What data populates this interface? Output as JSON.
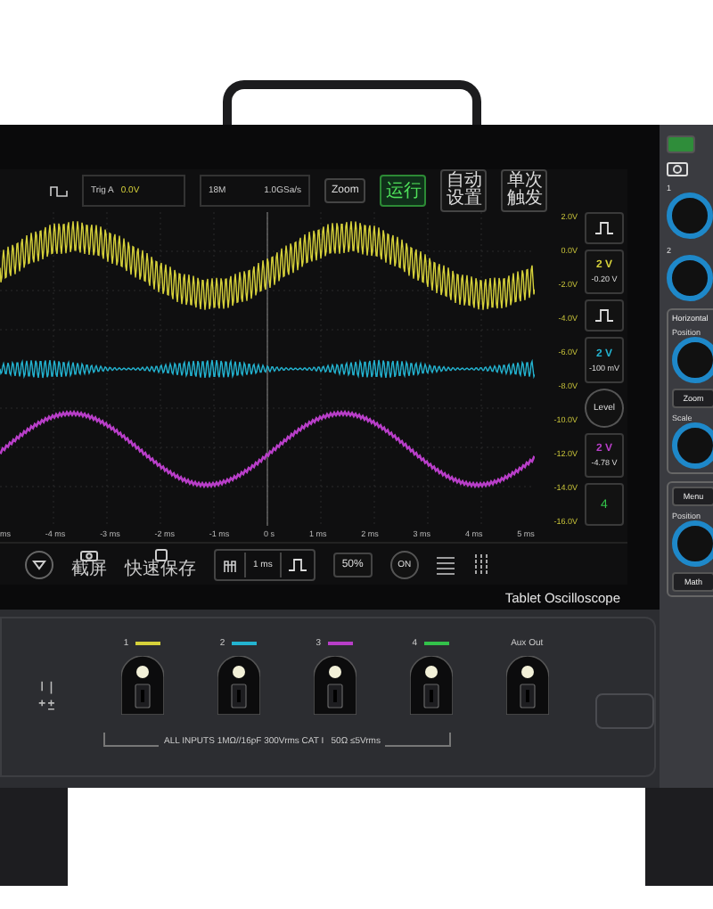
{
  "screen": {
    "top_bar": {
      "trigger": {
        "label": "Trig A",
        "level": "0.0V"
      },
      "acquisition": {
        "memory": "18M",
        "sample_rate": "1.0GSa/s"
      },
      "buttons": [
        {
          "label": "Zoom",
          "kind": "plain"
        },
        {
          "label": "运行",
          "kind": "run"
        },
        {
          "label": "自动设置",
          "kind": "stacked"
        },
        {
          "label": "单次触发",
          "kind": "stacked"
        }
      ]
    },
    "voltage_labels": [
      "2.0V",
      "0.0V",
      "-2.0V",
      "-4.0V",
      "-6.0V",
      "-8.0V",
      "-10.0V",
      "-12.0V",
      "-14.0V",
      "-16.0V"
    ],
    "channel_readouts": [
      {
        "scale": "2 V",
        "offset": "-0.20 V",
        "color": "#d6d13a"
      },
      {
        "scale": "2 V",
        "offset": "-100 mV",
        "color": "#23b3d0"
      },
      {
        "scale": "2 V",
        "offset": "-4.78 V",
        "color": "#b83ec8"
      }
    ],
    "level_button": "Level",
    "channel_4_button": {
      "label": "4",
      "color": "#33c24a"
    },
    "time_labels": [
      "ms",
      "-4 ms",
      "-3 ms",
      "-2 ms",
      "-1 ms",
      "0 s",
      "1 ms",
      "2 ms",
      "3 ms",
      "4 ms",
      "5 ms"
    ],
    "bottom_toolbar": [
      {
        "kind": "filter"
      },
      {
        "kind": "capture",
        "label": "截屏"
      },
      {
        "kind": "save",
        "label": "快速保存"
      },
      {
        "kind": "timebase",
        "label": "1 ms"
      },
      {
        "kind": "text",
        "label": "50%"
      },
      {
        "kind": "circle",
        "label": "ON"
      },
      {
        "kind": "lines"
      },
      {
        "kind": "bars"
      }
    ]
  },
  "brand_label": "Tablet Oscilloscope",
  "control_panel": {
    "knobs": [
      "1",
      "2"
    ],
    "horizontal": {
      "title": "Horizontal",
      "items": [
        {
          "kind": "knob",
          "label": "Position"
        },
        {
          "kind": "button",
          "label": "Zoom"
        },
        {
          "kind": "knob",
          "label": "Scale"
        }
      ]
    },
    "vertical": {
      "items": [
        {
          "kind": "button",
          "label": "Menu"
        },
        {
          "kind": "knob",
          "label": "Position"
        },
        {
          "kind": "button",
          "label": "Math"
        }
      ]
    }
  },
  "front_panel": {
    "inputs": [
      {
        "label": "1",
        "color": "#d6d13a"
      },
      {
        "label": "2",
        "color": "#23b3d0"
      },
      {
        "label": "3",
        "color": "#b83ec8"
      },
      {
        "label": "4",
        "color": "#33c24a"
      },
      {
        "label": "Aux Out"
      }
    ],
    "input_rating": "ALL INPUTS 1MΩ//16pF 300Vrms CAT I   50Ω ≤5Vrms"
  }
}
